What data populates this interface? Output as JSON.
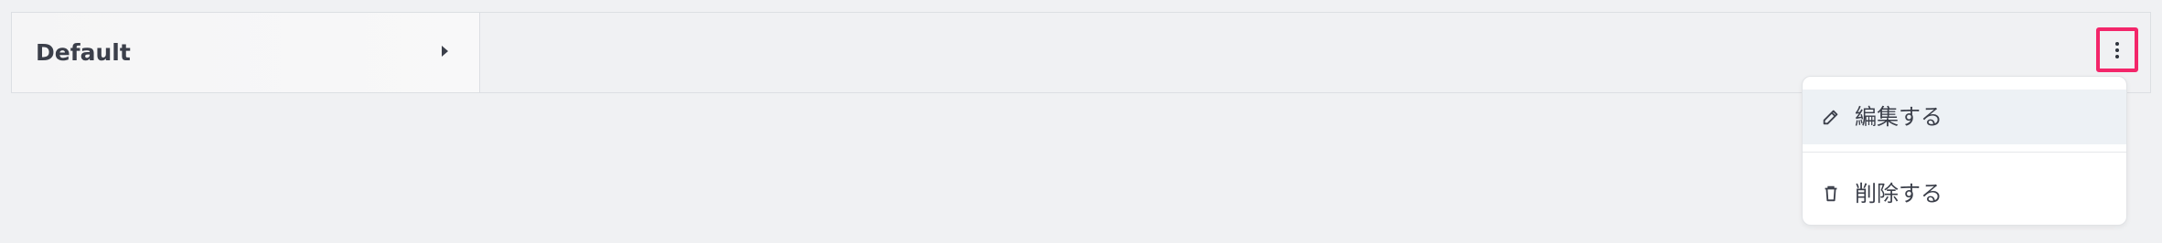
{
  "row": {
    "title": "Default",
    "expand_icon": "caret-right-icon"
  },
  "menu_button": {
    "icon": "more-vertical-icon",
    "highlight_color": "#f3266a"
  },
  "dropdown": {
    "items": [
      {
        "label": "編集する",
        "icon": "pencil-icon"
      },
      {
        "label": "削除する",
        "icon": "trash-icon"
      }
    ]
  }
}
